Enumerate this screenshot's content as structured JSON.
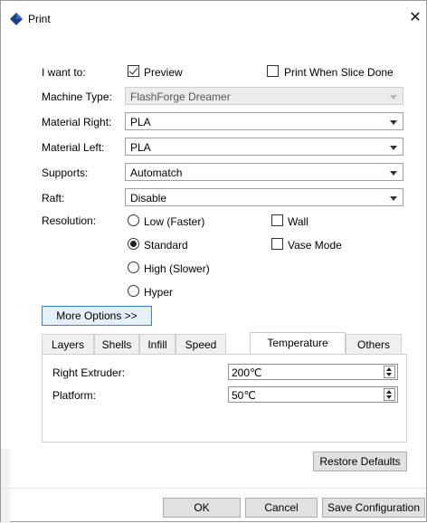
{
  "window": {
    "title": "Print",
    "close_glyph": "✕",
    "app_icon": "flashforge-diamond-icon"
  },
  "form": {
    "i_want_to_label": "I want to:",
    "preview_label": "Preview",
    "preview_checked": true,
    "print_when_done_label": "Print When Slice Done",
    "print_when_done_checked": false,
    "machine_type_label": "Machine Type:",
    "machine_type_value": "FlashForge Dreamer",
    "material_right_label": "Material Right:",
    "material_right_value": "PLA",
    "material_left_label": "Material Left:",
    "material_left_value": "PLA",
    "supports_label": "Supports:",
    "supports_value": "Automatch",
    "raft_label": "Raft:",
    "raft_value": "Disable",
    "resolution_label": "Resolution:",
    "resolution_options": [
      "Low (Faster)",
      "Standard",
      "High (Slower)",
      "Hyper"
    ],
    "resolution_selected": "Standard",
    "wall_label": "Wall",
    "vase_mode_label": "Vase Mode"
  },
  "more_options_label": "More Options >>",
  "tabs": [
    "Layers",
    "Shells",
    "Infill",
    "Speed",
    "Temperature",
    "Others"
  ],
  "active_tab": "Temperature",
  "temperature": {
    "right_extruder_label": "Right Extruder:",
    "right_extruder_value": "200℃",
    "platform_label": "Platform:",
    "platform_value": "50℃"
  },
  "buttons": {
    "restore_defaults": "Restore Defaults",
    "ok": "OK",
    "cancel": "Cancel",
    "save_configuration": "Save Configuration"
  },
  "colors": {
    "focus_border": "#3c7fd6",
    "focus_fill": "#e6f0fb",
    "button_face": "#e1e1e1"
  }
}
